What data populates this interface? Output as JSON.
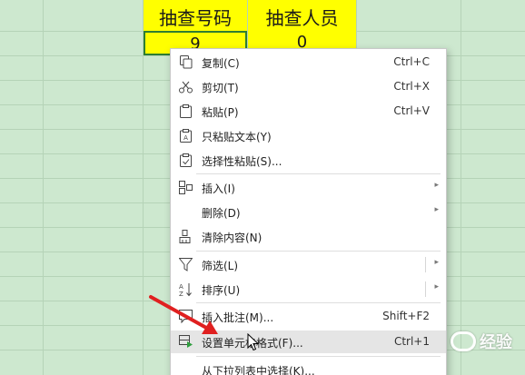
{
  "cells": {
    "header_a": "抽查号码",
    "header_b": "抽查人员",
    "value_a": "9",
    "value_b": "0"
  },
  "menu": {
    "copy": {
      "label": "复制(C)",
      "shortcut": "Ctrl+C",
      "icon": "copy-icon"
    },
    "cut": {
      "label": "剪切(T)",
      "shortcut": "Ctrl+X",
      "icon": "scissors-icon"
    },
    "paste": {
      "label": "粘贴(P)",
      "shortcut": "Ctrl+V",
      "icon": "clipboard-icon"
    },
    "paste_text": {
      "label": "只粘贴文本(Y)",
      "icon": "clipboard-text-icon"
    },
    "paste_special": {
      "label": "选择性粘贴(S)...",
      "icon": "clipboard-check-icon"
    },
    "insert": {
      "label": "插入(I)",
      "icon": "insert-icon"
    },
    "delete": {
      "label": "删除(D)"
    },
    "clear": {
      "label": "清除内容(N)",
      "icon": "eraser-icon"
    },
    "filter": {
      "label": "筛选(L)",
      "icon": "funnel-icon"
    },
    "sort": {
      "label": "排序(U)",
      "icon": "sort-az-icon"
    },
    "comment": {
      "label": "插入批注(M)...",
      "shortcut": "Shift+F2",
      "icon": "comment-icon"
    },
    "format_cells": {
      "label": "设置单元格格式(F)...",
      "shortcut": "Ctrl+1",
      "icon": "format-cells-icon"
    },
    "pick_list": {
      "label": "从下拉列表中选择(K)..."
    }
  },
  "watermark": {
    "text": "经验"
  },
  "colors": {
    "sheet_bg": "#cde8cf",
    "header_fill": "#ffff00",
    "selection_border": "#2e7d32",
    "highlight_row": "#e5e5e5",
    "arrow": "#e02020"
  }
}
